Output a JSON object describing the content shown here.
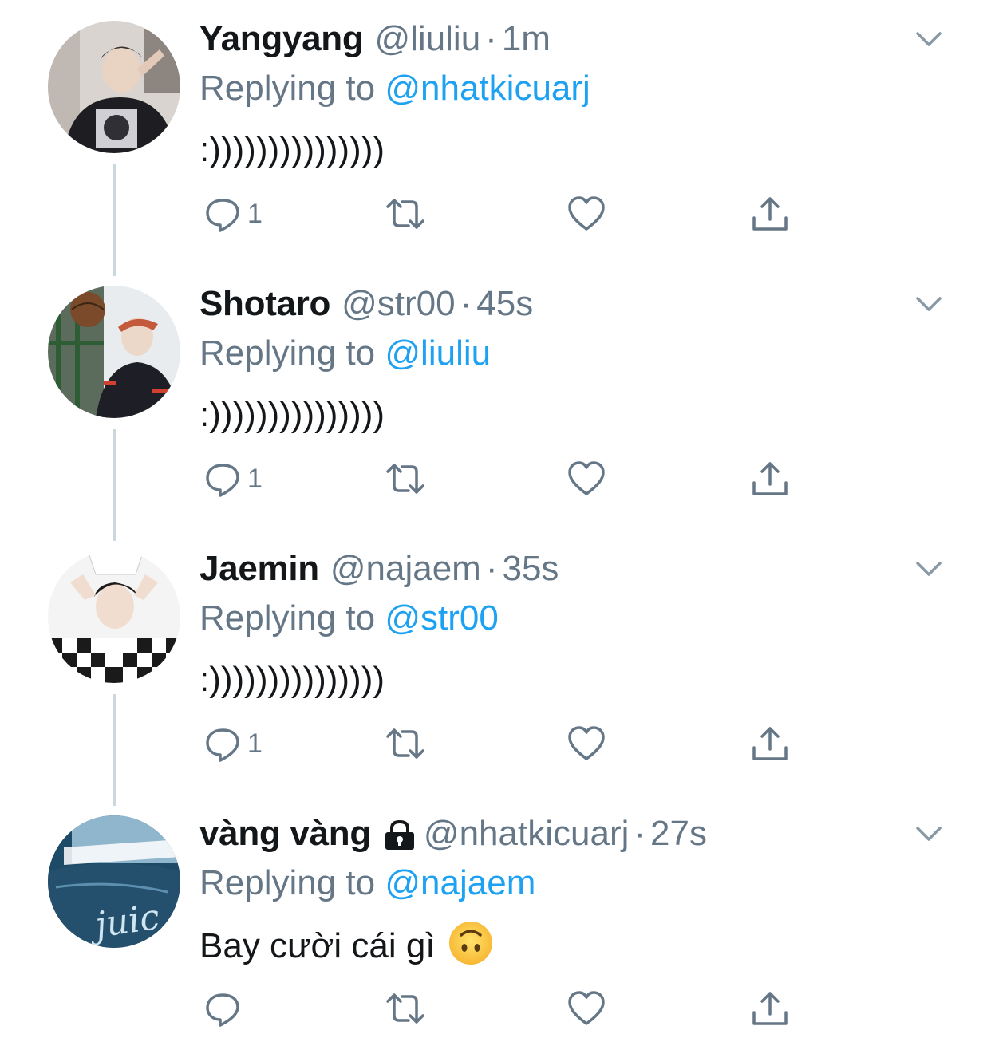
{
  "colors": {
    "name": "#14171a",
    "meta": "#657786",
    "link": "#1da1f2",
    "thread_line": "#ccd6dd"
  },
  "tweets": [
    {
      "name": "Yangyang",
      "handle": "@liuliu",
      "separator": "·",
      "time": "1m",
      "reply_prefix": "Replying to",
      "reply_to": "@nhatkicuarj",
      "text": ":)))))))))))))))",
      "reply_count": "1",
      "locked": false,
      "avatar_icon": "profile-photo"
    },
    {
      "name": "Shotaro",
      "handle": "@str00",
      "separator": "·",
      "time": "45s",
      "reply_prefix": "Replying to",
      "reply_to": "@liuliu",
      "text": ":)))))))))))))))",
      "reply_count": "1",
      "locked": false,
      "avatar_icon": "profile-photo"
    },
    {
      "name": "Jaemin",
      "handle": "@najaem",
      "separator": "·",
      "time": "35s",
      "reply_prefix": "Replying to",
      "reply_to": "@str00",
      "text": ":)))))))))))))))",
      "reply_count": "1",
      "locked": false,
      "avatar_icon": "profile-photo"
    },
    {
      "name": "vàng vàng",
      "handle": "@nhatkicuarj",
      "separator": "·",
      "time": "27s",
      "reply_prefix": "Replying to",
      "reply_to": "@najaem",
      "text": "Bay cười cái gì",
      "reply_count": "",
      "locked": true,
      "emoji": "upside-down-face",
      "avatar_icon": "profile-photo"
    }
  ],
  "icons": {
    "reply": "reply-icon",
    "retweet": "retweet-icon",
    "like": "heart-icon",
    "share": "share-icon",
    "menu": "chevron-down-icon",
    "protected": "lock-icon"
  }
}
